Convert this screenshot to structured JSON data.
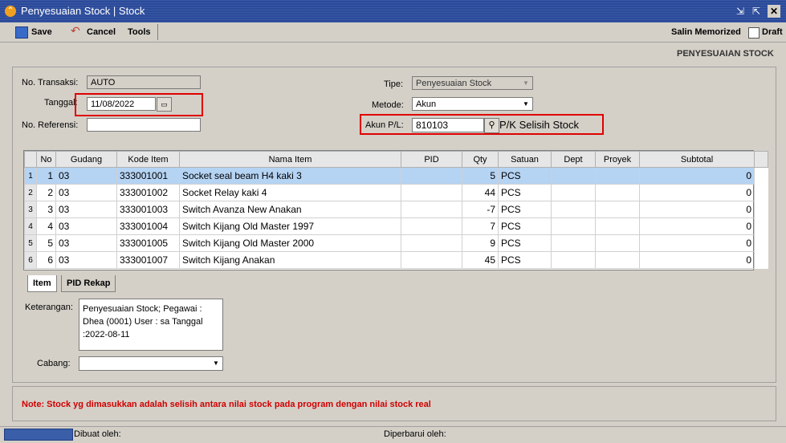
{
  "window": {
    "title": "Penyesuaian Stock | Stock"
  },
  "toolbar": {
    "save": "Save",
    "cancel": "Cancel",
    "tools": "Tools",
    "salin": "Salin Memorized",
    "draft": "Draft"
  },
  "header": {
    "form_title": "PENYESUAIAN STOCK"
  },
  "form": {
    "no_transaksi_label": "No. Transaksi:",
    "no_transaksi": "AUTO",
    "tanggal_label": "Tanggal:",
    "tanggal": "11/08/2022",
    "no_referensi_label": "No. Referensi:",
    "no_referensi": "",
    "tipe_label": "Tipe:",
    "tipe": "Penyesuaian Stock",
    "metode_label": "Metode:",
    "metode": "Akun",
    "akun_label": "Akun P/L:",
    "akun": "810103",
    "akun_name": "P/K Selisih Stock"
  },
  "grid": {
    "columns": [
      "No",
      "Gudang",
      "Kode Item",
      "Nama Item",
      "PID",
      "Qty",
      "Satuan",
      "Dept",
      "Proyek",
      "Subtotal"
    ],
    "rows": [
      {
        "rn": "1",
        "no": "1",
        "gudang": "03",
        "kode": "333001001",
        "nama": "Socket seal beam H4 kaki 3",
        "pid": "",
        "qty": "5",
        "satuan": "PCS",
        "dept": "",
        "proyek": "",
        "subtotal": "0"
      },
      {
        "rn": "2",
        "no": "2",
        "gudang": "03",
        "kode": "333001002",
        "nama": "Socket Relay kaki 4",
        "pid": "",
        "qty": "44",
        "satuan": "PCS",
        "dept": "",
        "proyek": "",
        "subtotal": "0"
      },
      {
        "rn": "3",
        "no": "3",
        "gudang": "03",
        "kode": "333001003",
        "nama": "Switch Avanza New Anakan",
        "pid": "",
        "qty": "-7",
        "satuan": "PCS",
        "dept": "",
        "proyek": "",
        "subtotal": "0"
      },
      {
        "rn": "4",
        "no": "4",
        "gudang": "03",
        "kode": "333001004",
        "nama": "Switch Kijang Old Master 1997",
        "pid": "",
        "qty": "7",
        "satuan": "PCS",
        "dept": "",
        "proyek": "",
        "subtotal": "0"
      },
      {
        "rn": "5",
        "no": "5",
        "gudang": "03",
        "kode": "333001005",
        "nama": "Switch Kijang Old Master 2000",
        "pid": "",
        "qty": "9",
        "satuan": "PCS",
        "dept": "",
        "proyek": "",
        "subtotal": "0"
      },
      {
        "rn": "6",
        "no": "6",
        "gudang": "03",
        "kode": "333001007",
        "nama": "Switch Kijang Anakan",
        "pid": "",
        "qty": "45",
        "satuan": "PCS",
        "dept": "",
        "proyek": "",
        "subtotal": "0"
      }
    ]
  },
  "tabs": {
    "item": "Item",
    "pid_rekap": "PID Rekap"
  },
  "bottom": {
    "keterangan_label": "Keterangan:",
    "keterangan": "Penyesuaian Stock; Pegawai : Dhea (0001) User : sa Tanggal :2022-08-11",
    "cabang_label": "Cabang:",
    "cabang": ""
  },
  "note": "Note:  Stock yg dimasukkan adalah selisih antara nilai stock pada program dengan nilai stock real",
  "status": {
    "dibuat": "Dibuat oleh:",
    "diperbarui": "Diperbarui oleh:"
  },
  "colors": {
    "accent": "#e00000",
    "selection": "#b5d3f3",
    "titlebar": "#2a4a9a"
  }
}
